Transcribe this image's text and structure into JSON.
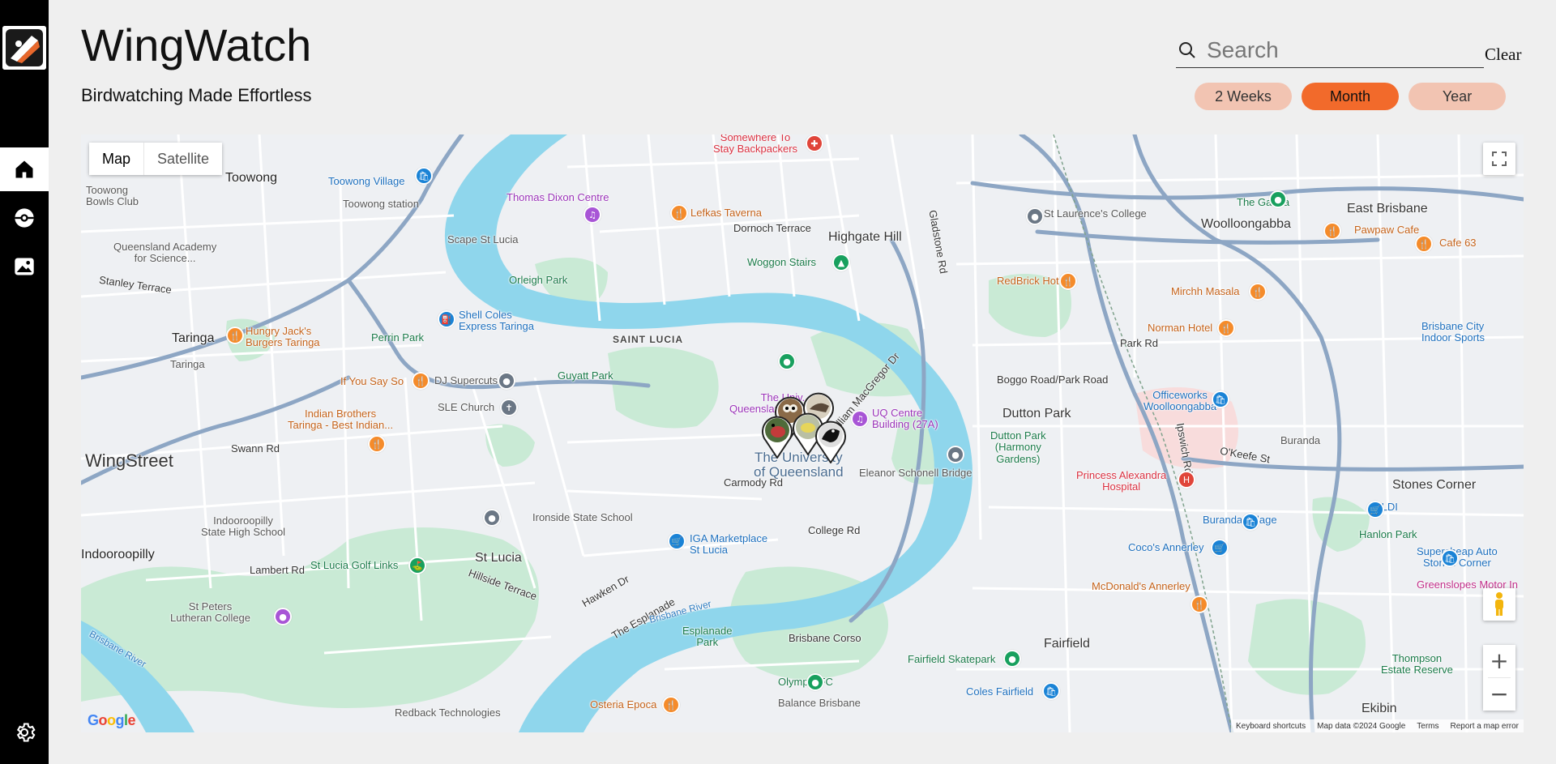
{
  "app": {
    "title": "WingWatch",
    "subtitle": "Birdwatching Made Effortless"
  },
  "sidebar": {
    "items": [
      {
        "name": "home",
        "icon": "home-icon",
        "active": true
      },
      {
        "name": "pokeball",
        "icon": "pokeball-icon",
        "active": false
      },
      {
        "name": "gallery",
        "icon": "image-icon",
        "active": false
      },
      {
        "name": "settings",
        "icon": "gear-icon",
        "active": false
      }
    ]
  },
  "search": {
    "placeholder": "Search",
    "value": "",
    "clear_label": "Clear"
  },
  "time_range": {
    "options": [
      "2 Weeks",
      "Month",
      "Year"
    ],
    "selected": "Month"
  },
  "map": {
    "type_map": "Map",
    "type_satellite": "Satellite",
    "selected_type": "Map",
    "zoom_in": "+",
    "zoom_out": "−",
    "google": "Google",
    "keyboard_shortcuts": "Keyboard shortcuts",
    "map_data": "Map data ©2024 Google",
    "terms": "Terms",
    "report": "Report a map error",
    "labels": {
      "toowong": "Toowong",
      "toowong_bowls": "Toowong\nBowls Club",
      "toowong_village": "Toowong Village",
      "toowong_station": "Toowong station",
      "qld_academy": "Queensland Academy\nfor Science...",
      "stanley_terrace": "Stanley Terrace",
      "taringa": "Taringa",
      "taringa_station": "Taringa",
      "hungry_jacks": "Hungry Jack's\nBurgers Taringa",
      "if_you_say_so": "If You Say So",
      "indian_brothers": "Indian Brothers\nTaringa - Best Indian...",
      "swann_rd": "Swann Rd",
      "wingstreet": "WingStreet",
      "indooroopilly_shs": "Indooroopilly\nState High School",
      "indooroopilly": "Indooroopilly",
      "lambert_rd": "Lambert Rd",
      "st_peters": "St Peters\nLutheran College",
      "scape": "Scape St Lucia",
      "thomas_dixon": "Thomas Dixon Centre",
      "somewhere_to_stay": "Somewhere To\nStay Backpackers",
      "lefkas": "Lefkas Taverna",
      "highgate_hill": "Highgate Hill",
      "woggon": "Woggon Stairs",
      "orleigh_park": "Orleigh Park",
      "shell_coles": "Shell Coles\nExpress Taringa",
      "perrin_park": "Perrin Park",
      "saint_lucia": "SAINT LUCIA",
      "guyatt_park": "Guyatt Park",
      "dj_supercuts": "DJ Supercuts",
      "sle_church": "SLE Church",
      "ironside": "Ironside State School",
      "st_lucia": "St Lucia",
      "st_lucia_golf": "St Lucia Golf Links",
      "iga": "IGA Marketplace\nSt Lucia",
      "uq": "The University\nof Queensland",
      "uq_art": "The Univ...\nQueensland Art...",
      "uq_centre": "UQ Centre\nBuilding (27A)",
      "eleanor": "Eleanor Schonell Bridge",
      "dutton_park": "Dutton Park",
      "dutton_park_harmony": "Dutton Park\n(Harmony\nGardens)",
      "st_laurences": "St Laurence's College",
      "redbrick": "RedBrick Hotel",
      "woolloongabba": "Woolloongabba",
      "the_gabba": "The Gabba",
      "east_brisbane": "East Brisbane",
      "pawpaw": "Pawpaw Cafe",
      "cafe63": "Cafe 63",
      "mirchh": "Mirchh Masala",
      "norman": "Norman Hotel",
      "brisbane_city": "Brisbane City\nIndoor Sports",
      "office_works": "Officeworks\nWoolloongabba",
      "boggo_rd": "Boggo Road/Park Road",
      "park_rd": "Park Rd",
      "princess_alexandra": "Princess Alexandra\nHospital",
      "buranda": "Buranda",
      "buranda_village": "Buranda Village",
      "stones_corner": "Stones Corner",
      "aldi": "ALDI",
      "hanlon": "Hanlon Park",
      "supercheap": "Supercheap Auto\nStones Corner",
      "cocos": "Coco's Annerley",
      "mcdonalds": "McDonald's Annerley",
      "greenslopes": "Greenslopes Motor In",
      "thompson": "Thompson\nEstate Reserve",
      "ekibin": "Ekibin",
      "fairfield": "Fairfield",
      "fairfield_skate": "Fairfield Skatepark",
      "coles_fairfield": "Coles Fairfield",
      "olympic_fc": "Olympic FC",
      "balance": "Balance Brisbane",
      "brisbane_corso": "Brisbane Corso",
      "esplanade_park": "Esplanade\nPark",
      "brisbane_river": "Brisbane River",
      "osteria": "Osteria Epoca",
      "redback": "Redback Technologies",
      "college_rd": "College Rd",
      "carmody_rd": "Carmody Rd",
      "hawken_dr": "Hawken Dr",
      "the_esplanade": "The Esplanade",
      "hillside": "Hillside Terrace",
      "sir_william": "Sir William MacGregor Dr",
      "dornoch": "Dornoch Terrace",
      "gladstone": "Gladstone Rd",
      "ipswich_rd": "Ipswich Rd",
      "okeefe": "O'Keefe St",
      "brisbane_river_w": "Brisbane River"
    }
  },
  "colors": {
    "accent": "#f26a2b",
    "accent_light": "#f2c4b2",
    "sidebar": "#000000",
    "water": "#8fd6ec",
    "park": "#bfe6cc",
    "road_major": "#8da6c4"
  }
}
